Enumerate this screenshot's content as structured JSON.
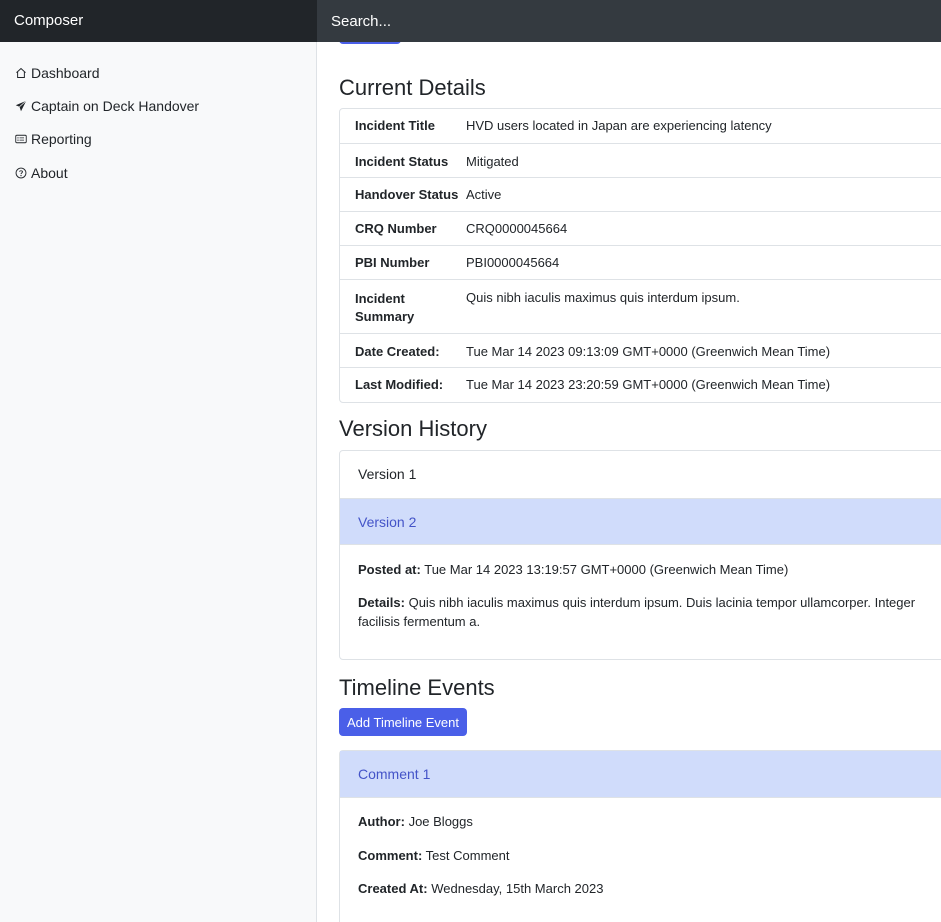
{
  "app": {
    "brand": "Composer",
    "search_placeholder": "Search..."
  },
  "sidebar": {
    "items": [
      {
        "label": "Dashboard",
        "icon": "house-icon"
      },
      {
        "label": "Captain on Deck Handover",
        "icon": "send-icon"
      },
      {
        "label": "Reporting",
        "icon": "card-list-icon"
      },
      {
        "label": "About",
        "icon": "question-circle-icon"
      }
    ]
  },
  "current_details": {
    "heading": "Current Details",
    "rows": [
      {
        "key": "Incident Title",
        "value": "HVD users located in Japan are experiencing latency"
      },
      {
        "key": "Incident Status",
        "value": "Mitigated"
      },
      {
        "key": "Handover Status",
        "value": "Active"
      },
      {
        "key": "CRQ Number",
        "value": "CRQ0000045664"
      },
      {
        "key": "PBI Number",
        "value": "PBI0000045664"
      },
      {
        "key": "Incident Summary",
        "value": "Quis nibh iaculis maximus quis interdum ipsum."
      },
      {
        "key": "Date Created:",
        "value": "Tue Mar 14 2023 09:13:09 GMT+0000 (Greenwich Mean Time)"
      },
      {
        "key": "Last Modified:",
        "value": "Tue Mar 14 2023 23:20:59 GMT+0000 (Greenwich Mean Time)"
      }
    ]
  },
  "version_history": {
    "heading": "Version History",
    "versions": [
      {
        "label": "Version 1"
      },
      {
        "label": "Version 2"
      }
    ],
    "expanded": {
      "posted_label": "Posted at:",
      "posted_value": "Tue Mar 14 2023 13:19:57 GMT+0000 (Greenwich Mean Time)",
      "details_label": "Details:",
      "details_value": "Quis nibh iaculis maximus quis interdum ipsum. Duis lacinia tempor ullamcorper. Integer facilisis fermentum a."
    }
  },
  "timeline": {
    "heading": "Timeline Events",
    "add_button": "Add Timeline Event",
    "comment": {
      "label": "Comment 1",
      "author_label": "Author:",
      "author_value": "Joe Bloggs",
      "comment_label": "Comment:",
      "comment_value": "Test Comment",
      "created_label": "Created At:",
      "created_value": "Wednesday, 15th March 2023"
    }
  },
  "colors": {
    "accent": "#4a5fe8",
    "active_header_bg": "#d0dcfb",
    "active_header_text": "#4454c8",
    "topbar": "#343a40",
    "brand_bar": "#212529"
  }
}
